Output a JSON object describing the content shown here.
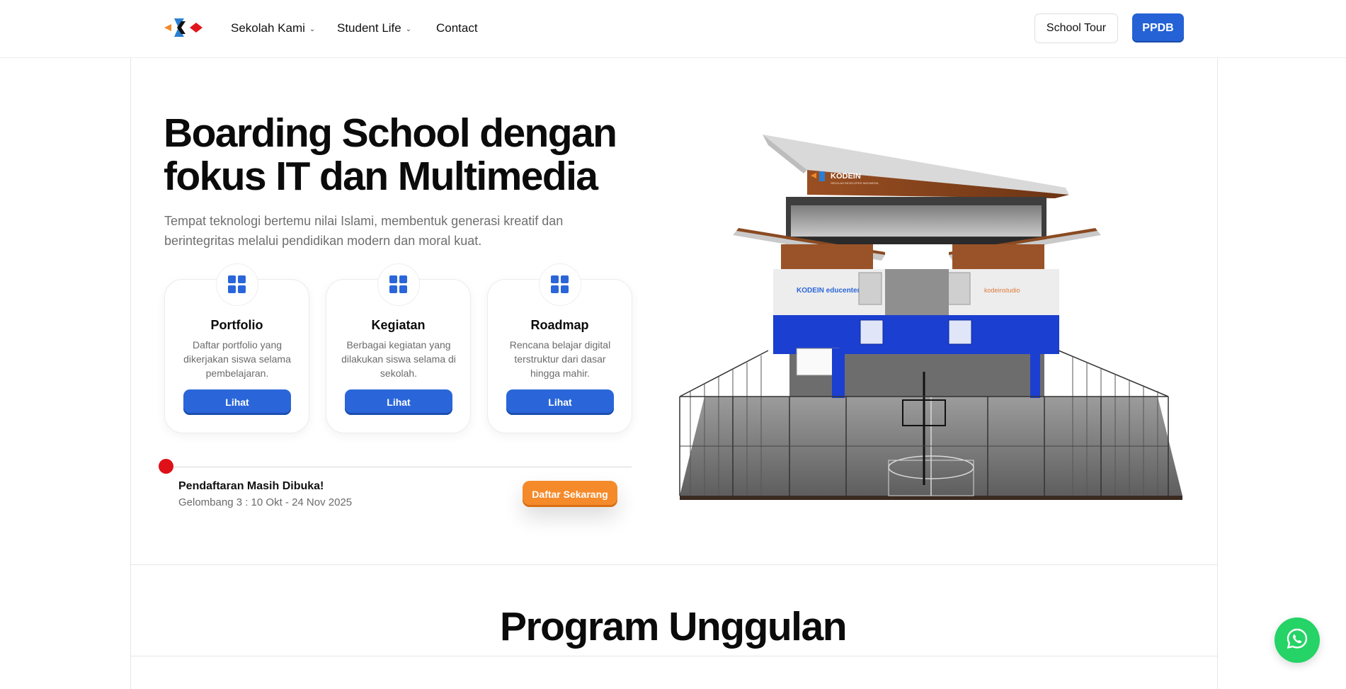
{
  "nav": {
    "logo_icon": "kodein-logo",
    "items": [
      {
        "label": "Sekolah Kami",
        "has_dropdown": true
      },
      {
        "label": "Student Life",
        "has_dropdown": true
      },
      {
        "label": "Contact",
        "has_dropdown": false
      }
    ],
    "tour_label": "School Tour",
    "ppdb_label": "PPDB"
  },
  "hero": {
    "title_line1": "Boarding School dengan",
    "title_line2": "fokus IT dan Multimedia",
    "subtitle": "Tempat teknologi bertemu nilai Islami, membentuk generasi kreatif dan berintegritas melalui pendidikan modern dan moral kuat."
  },
  "cards": [
    {
      "icon": "grid-icon",
      "title": "Portfolio",
      "desc": "Daftar portfolio yang dikerjakan siswa selama pembelajaran.",
      "button": "Lihat"
    },
    {
      "icon": "grid-icon",
      "title": "Kegiatan",
      "desc": "Berbagai kegiatan yang dilakukan siswa selama di sekolah.",
      "button": "Lihat"
    },
    {
      "icon": "grid-icon",
      "title": "Roadmap",
      "desc": "Rencana belajar digital terstruktur dari dasar hingga mahir.",
      "button": "Lihat"
    }
  ],
  "registration": {
    "title": "Pendaftaran Masih Dibuka!",
    "period": "Gelombang 3 : 10 Okt - 24 Nov 2025",
    "button": "Daftar Sekarang"
  },
  "building": {
    "sign_main": "KODEIN",
    "sign_sub": "SEKOLAH DEVELOPER INDONESIA",
    "panel_left": "KODEIN educenter",
    "panel_right": "kodeinstudio"
  },
  "section": {
    "title": "Program Unggulan"
  },
  "colors": {
    "primary": "#2462d6",
    "accent": "#f58a2b",
    "dot": "#e01018",
    "whatsapp": "#25d366"
  },
  "floating": {
    "icon": "whatsapp-icon"
  }
}
